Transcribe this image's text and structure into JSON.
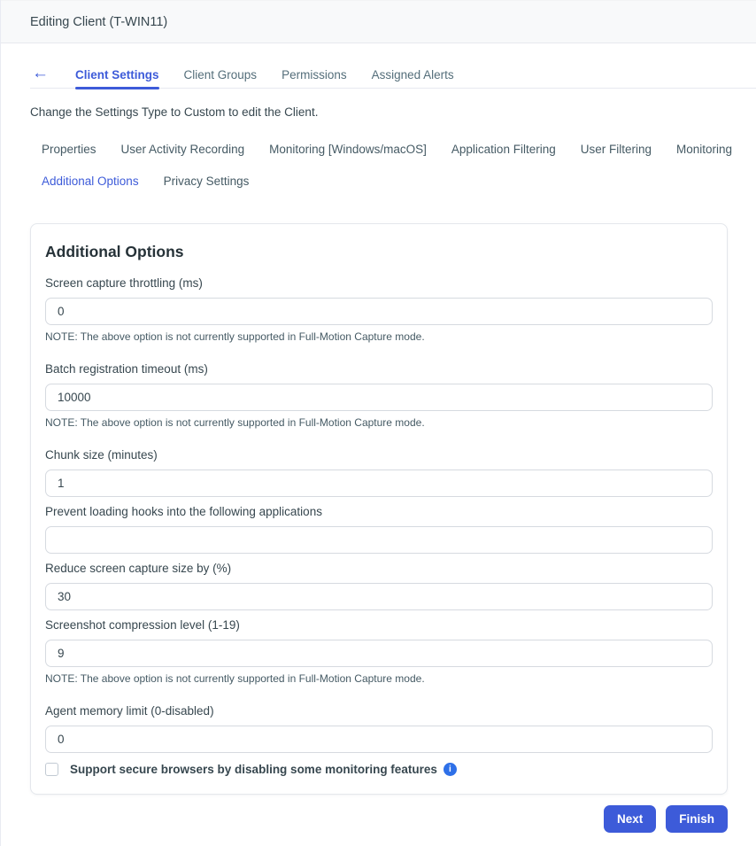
{
  "colors": {
    "accent_blue": "#3d5bd9",
    "info_icon_blue": "#2e70e8",
    "header_bg": "#f8f9fa"
  },
  "header": {
    "title": "Editing Client (T-WIN11)"
  },
  "tabs": {
    "back_icon": "←",
    "items": [
      {
        "label": "Client Settings",
        "active": true
      },
      {
        "label": "Client Groups",
        "active": false
      },
      {
        "label": "Permissions",
        "active": false
      },
      {
        "label": "Assigned Alerts",
        "active": false
      }
    ]
  },
  "hint": "Change the Settings Type to Custom to edit the Client.",
  "subtabs": {
    "row1": [
      {
        "label": "Properties"
      },
      {
        "label": "User Activity Recording"
      },
      {
        "label": "Monitoring [Windows/macOS]"
      },
      {
        "label": "Application Filtering"
      },
      {
        "label": "User Filtering"
      },
      {
        "label": "Monitoring"
      }
    ],
    "row2": [
      {
        "label": "Additional Options",
        "active": true
      },
      {
        "label": "Privacy Settings",
        "active": false
      }
    ]
  },
  "card": {
    "title": "Additional Options",
    "fields": [
      {
        "label": "Screen capture throttling (ms)",
        "value": "0",
        "note": "NOTE: The above option is not currently supported in Full-Motion Capture mode."
      },
      {
        "label": "Batch registration timeout (ms)",
        "value": "10000",
        "note": "NOTE: The above option is not currently supported in Full-Motion Capture mode."
      },
      {
        "label": "Chunk size (minutes)",
        "value": "1"
      },
      {
        "label": "Prevent loading hooks into the following applications",
        "value": ""
      },
      {
        "label": "Reduce screen capture size by (%)",
        "value": "30"
      },
      {
        "label": "Screenshot compression level (1-19)",
        "value": "9",
        "note": "NOTE: The above option is not currently supported in Full-Motion Capture mode."
      },
      {
        "label": "Agent memory limit (0-disabled)",
        "value": "0"
      }
    ],
    "checkbox": {
      "label": "Support secure browsers by disabling some monitoring features",
      "checked": false,
      "info_icon": "i"
    }
  },
  "footer": {
    "next_label": "Next",
    "finish_label": "Finish"
  }
}
